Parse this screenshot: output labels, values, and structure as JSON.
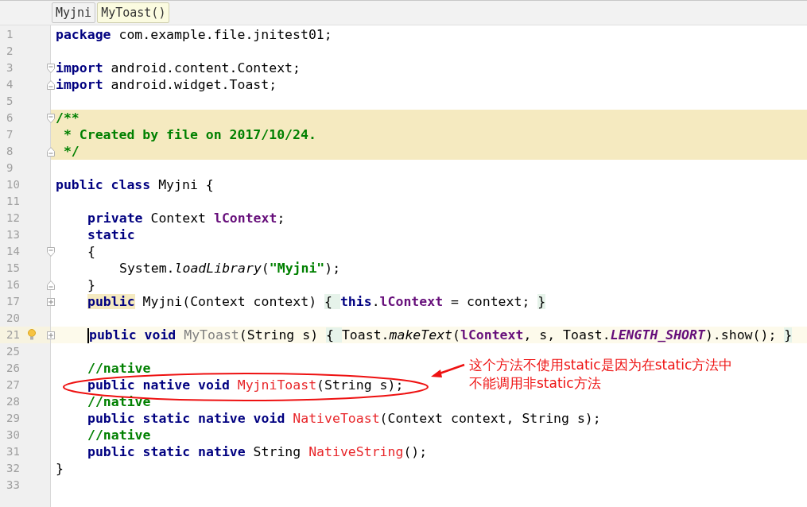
{
  "breadcrumbs": [
    {
      "label": "Myjni",
      "selected": false
    },
    {
      "label": "MyToast()",
      "selected": true
    }
  ],
  "lines": [
    {
      "number": "1",
      "tokens": [
        {
          "kind": "kw",
          "t": "package"
        },
        {
          "kind": "plain",
          "t": " com.example.file.jnitest01;"
        }
      ]
    },
    {
      "number": "2"
    },
    {
      "number": "3",
      "fold": {
        "kind": "open"
      },
      "tokens": [
        {
          "kind": "kw",
          "t": "import"
        },
        {
          "kind": "plain",
          "t": " android.content.Context;"
        }
      ]
    },
    {
      "number": "4",
      "fold": {
        "kind": "close"
      },
      "tokens": [
        {
          "kind": "kw",
          "t": "import"
        },
        {
          "kind": "plain",
          "t": " android.widget.Toast;"
        }
      ]
    },
    {
      "number": "5"
    },
    {
      "number": "6",
      "fold": {
        "kind": "open"
      },
      "doc_comment": true,
      "tokens": [
        {
          "kind": "doc",
          "t": "/**"
        }
      ]
    },
    {
      "number": "7",
      "doc_comment": true,
      "tokens": [
        {
          "kind": "doc",
          "t": " * Created by file on 2017/10/24."
        }
      ]
    },
    {
      "number": "8",
      "fold": {
        "kind": "close"
      },
      "doc_comment": true,
      "tokens": [
        {
          "kind": "doc",
          "t": " */"
        }
      ]
    },
    {
      "number": "9"
    },
    {
      "number": "10",
      "tokens": [
        {
          "kind": "kw",
          "t": "public class"
        },
        {
          "kind": "plain",
          "t": " Myjni {"
        }
      ]
    },
    {
      "number": "11"
    },
    {
      "number": "12",
      "kind": "member",
      "tokens": [
        {
          "kind": "kw",
          "t": "private"
        },
        {
          "kind": "plain",
          "t": " Context "
        },
        {
          "kind": "field",
          "t": "lContext"
        },
        {
          "kind": "plain",
          "t": ";"
        }
      ]
    },
    {
      "number": "13",
      "kind": "member",
      "tokens": [
        {
          "kind": "kw",
          "t": "static"
        }
      ]
    },
    {
      "number": "14",
      "kind": "member",
      "fold": {
        "kind": "open"
      },
      "tokens": [
        {
          "kind": "plain",
          "t": "{"
        }
      ]
    },
    {
      "number": "15",
      "kind": "body",
      "tokens": [
        {
          "kind": "plain",
          "t": "System."
        },
        {
          "kind": "call",
          "t": "loadLibrary"
        },
        {
          "kind": "plain",
          "t": "("
        },
        {
          "kind": "string",
          "t": "\"Myjni\""
        },
        {
          "kind": "plain",
          "t": ");"
        }
      ]
    },
    {
      "number": "16",
      "kind": "member",
      "fold": {
        "kind": "close"
      },
      "tokens": [
        {
          "kind": "plain",
          "t": "}"
        }
      ]
    },
    {
      "number": "17",
      "kind": "member",
      "fold": {
        "kind": "plus"
      },
      "tokens": [
        {
          "kind": "kwmark",
          "t": "public"
        },
        {
          "kind": "plain",
          "t": " Myjni(Context context) "
        },
        {
          "kind": "folded",
          "t": "{ "
        },
        {
          "kind": "kw",
          "t": "this"
        },
        {
          "kind": "plain",
          "t": "."
        },
        {
          "kind": "field",
          "t": "lContext"
        },
        {
          "kind": "plain",
          "t": " = context; "
        },
        {
          "kind": "folded",
          "t": "}"
        }
      ]
    },
    {
      "number": "20"
    },
    {
      "number": "21",
      "kind": "member",
      "fold": {
        "kind": "plus"
      },
      "caret_line": true,
      "bulb": true,
      "tokens": [
        {
          "kind": "kw",
          "t": "public void",
          "caret_before": true
        },
        {
          "kind": "unused",
          "t": " MyToast"
        },
        {
          "kind": "plain",
          "t": "(String s) "
        },
        {
          "kind": "folded",
          "t": "{ "
        },
        {
          "kind": "plain",
          "t": "Toast."
        },
        {
          "kind": "call",
          "t": "makeText"
        },
        {
          "kind": "plain",
          "t": "("
        },
        {
          "kind": "field",
          "t": "lContext"
        },
        {
          "kind": "plain",
          "t": ", s, Toast."
        },
        {
          "kind": "const",
          "t": "LENGTH_SHORT"
        },
        {
          "kind": "plain",
          "t": ").show(); "
        },
        {
          "kind": "folded",
          "t": "}"
        }
      ]
    },
    {
      "number": "25"
    },
    {
      "number": "26",
      "kind": "member",
      "tokens": [
        {
          "kind": "comment",
          "t": "//native"
        }
      ]
    },
    {
      "number": "27",
      "kind": "member",
      "tokens": [
        {
          "kind": "kw",
          "t": "public native void"
        },
        {
          "kind": "native",
          "t": " MyjniToast"
        },
        {
          "kind": "plain",
          "t": "(String s);"
        }
      ]
    },
    {
      "number": "28",
      "kind": "member",
      "tokens": [
        {
          "kind": "comment",
          "t": "//native"
        }
      ]
    },
    {
      "number": "29",
      "kind": "member",
      "tokens": [
        {
          "kind": "kw",
          "t": "public static native void"
        },
        {
          "kind": "native",
          "t": " NativeToast"
        },
        {
          "kind": "plain",
          "t": "(Context context, String s);"
        }
      ]
    },
    {
      "number": "30",
      "kind": "member",
      "tokens": [
        {
          "kind": "comment",
          "t": "//native"
        }
      ]
    },
    {
      "number": "31",
      "kind": "member",
      "tokens": [
        {
          "kind": "kw",
          "t": "public static native"
        },
        {
          "kind": "plain",
          "t": " String "
        },
        {
          "kind": "native",
          "t": "NativeString"
        },
        {
          "kind": "plain",
          "t": "();"
        }
      ]
    },
    {
      "number": "32",
      "tokens": [
        {
          "kind": "plain",
          "t": "}"
        }
      ]
    },
    {
      "number": "33"
    }
  ],
  "annotation": {
    "lines": [
      "这个方法不使用static是因为在static方法中",
      "不能调用非static方法"
    ]
  }
}
